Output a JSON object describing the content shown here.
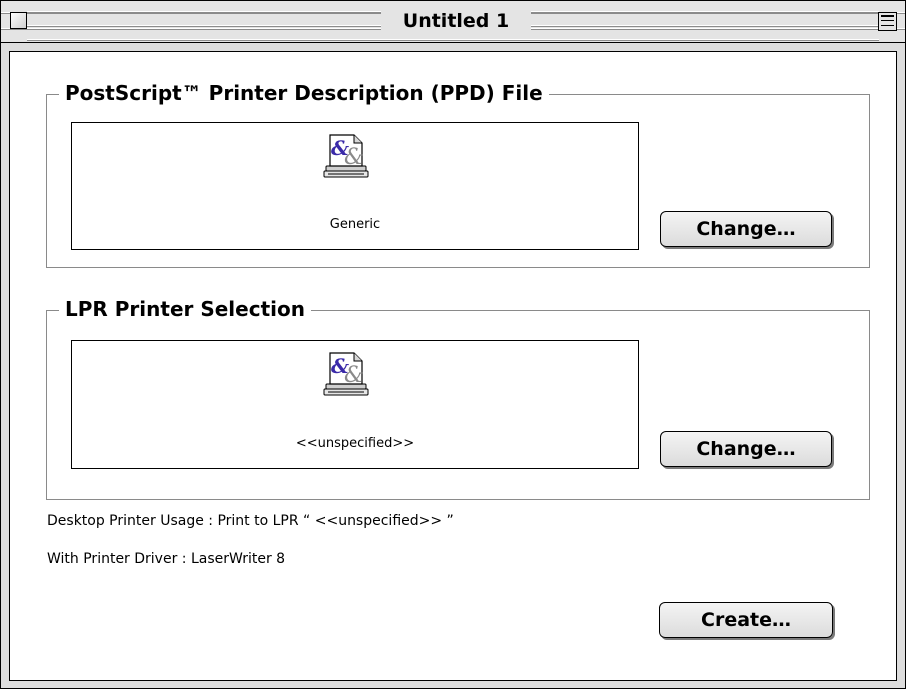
{
  "window": {
    "title": "Untitled 1"
  },
  "ppd_section": {
    "legend": "PostScript™ Printer Description (PPD) File",
    "file_name": "Generic",
    "change_label": "Change…"
  },
  "lpr_section": {
    "legend": "LPR Printer Selection",
    "printer_name": "<<unspecified>>",
    "change_label": "Change…"
  },
  "info": {
    "usage_line": "Desktop Printer Usage : Print to LPR “ <<unspecified>> ”",
    "driver_line": "With Printer Driver : LaserWriter 8"
  },
  "actions": {
    "create_label": "Create…"
  },
  "colors": {
    "window_background": "#dddddd",
    "content_background": "#ffffff",
    "icon_ampersand_front": "#3a2aa8",
    "icon_ampersand_back": "#8a8a8a"
  },
  "icons": {
    "document_icon": "ppd-document-icon"
  }
}
